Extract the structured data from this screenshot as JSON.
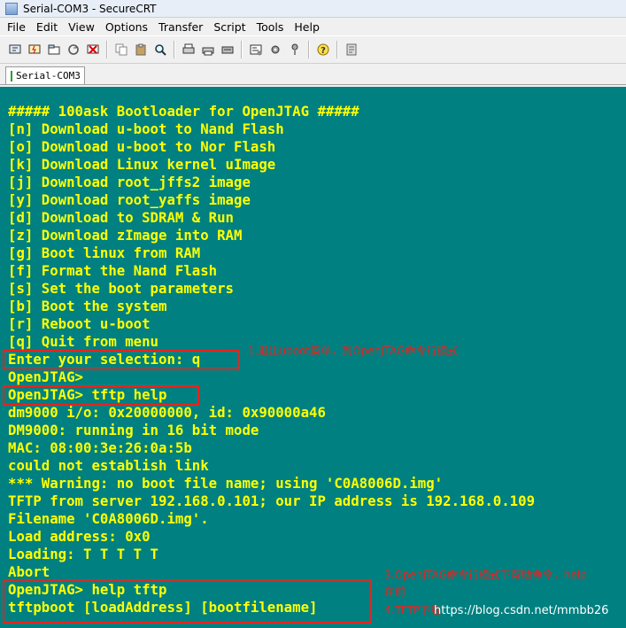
{
  "window": {
    "title": "Serial-COM3 - SecureCRT"
  },
  "menu": [
    "File",
    "Edit",
    "View",
    "Options",
    "Transfer",
    "Script",
    "Tools",
    "Help"
  ],
  "toolbar": {
    "icons": [
      "connect-icon",
      "quick-connect-icon",
      "connect-tab-icon",
      "reconnect-icon",
      "disconnect-icon",
      "copy-icon",
      "paste-icon",
      "find-icon",
      "print-icon",
      "print-setup-icon",
      "print-screen-icon",
      "session-options-icon",
      "global-options-icon",
      "key-map-icon",
      "help-icon",
      "log-icon"
    ]
  },
  "tab": {
    "label": "Serial-COM3"
  },
  "terminal": {
    "colors": {
      "background": "#008080",
      "text": "#ffff00"
    },
    "lines": [
      "##### 100ask Bootloader for OpenJTAG #####",
      "[n] Download u-boot to Nand Flash",
      "[o] Download u-boot to Nor Flash",
      "[k] Download Linux kernel uImage",
      "[j] Download root_jffs2 image",
      "[y] Download root_yaffs image",
      "[d] Download to SDRAM & Run",
      "[z] Download zImage into RAM",
      "[g] Boot linux from RAM",
      "[f] Format the Nand Flash",
      "[s] Set the boot parameters",
      "[b] Boot the system",
      "[r] Reboot u-boot",
      "[q] Quit from menu",
      "Enter your selection: q",
      "OpenJTAG>",
      "OpenJTAG> tftp help",
      "dm9000 i/o: 0x20000000, id: 0x90000a46",
      "DM9000: running in 16 bit mode",
      "MAC: 08:00:3e:26:0a:5b",
      "could not establish link",
      "*** Warning: no boot file name; using 'C0A8006D.img'",
      "TFTP from server 192.168.0.101; our IP address is 192.168.0.109",
      "Filename 'C0A8006D.img'.",
      "Load address: 0x0",
      "Loading: T T T T T",
      "Abort",
      "OpenJTAG> help tftp",
      "tftpboot [loadAddress] [bootfilename]"
    ]
  },
  "annotations": {
    "note1": "1.退出uboot菜单，到OpenJTAG命令行模式",
    "note3_line1": "3.OpenJTAG命令行模式下帮助命令，help",
    "note3_line2": "在前",
    "note4": "4.TFTP下载"
  },
  "watermark": "https://blog.csdn.net/mmbb26"
}
